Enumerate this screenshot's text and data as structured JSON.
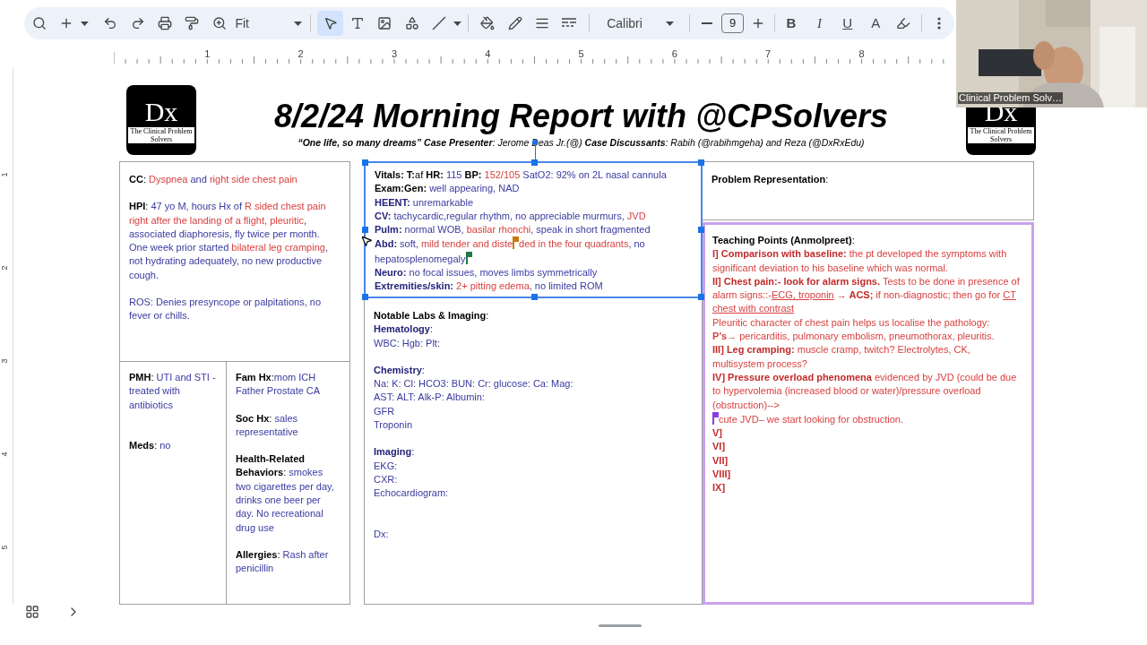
{
  "toolbar": {
    "zoom": "Fit",
    "tools": [
      {
        "selected": true
      },
      {
        "selected": false
      },
      {
        "selected": false
      },
      {
        "selected": false
      },
      {
        "selected": false
      }
    ],
    "font": "Calibri",
    "font_size": "9",
    "format_buttons": [
      "B",
      "I",
      "U",
      "A"
    ]
  },
  "ruler": {
    "numbers": [
      "1",
      "2",
      "3",
      "4",
      "5",
      "6",
      "7",
      "8"
    ]
  },
  "vertical_ruler": {
    "numbers": [
      "1",
      "2",
      "3",
      "4",
      "5"
    ]
  },
  "webcam": {
    "caption": "Clinical Problem Solv…"
  },
  "slide": {
    "logos": [
      {
        "letters": "Dx",
        "caption": "The Clinical Problem Solvers"
      },
      {
        "letters": "Dx",
        "caption": "The Clinical Problem Solvers"
      }
    ],
    "title": "8/2/24 Morning Report with @CPSolvers",
    "subtitle": "**“One life, so many dreams” Case Presenter**: Jerome Deas Jr.(@) **Case Discussants**: Rabih (@rabihmgeha) and Reza (@DxRxEdu)",
    "history": [
      [
        [
          {
            "text": "**CC**: ",
            "color": "#000000",
            "kind": "plain"
          },
          {
            "text": "Dyspnea",
            "color": "#d8403f",
            "kind": "plain"
          },
          {
            "text": " and ",
            "color": "#3a3aa0",
            "kind": "plain"
          },
          {
            "text": "right side chest pain",
            "color": "#d8403f",
            "kind": "plain"
          }
        ]
      ],
      [
        [
          {
            "text": "**HPI**:",
            "color": "#000000",
            "kind": "plain"
          },
          {
            "text": "  47 yo M, hours Hx of ",
            "color": "#3a3aa0",
            "kind": "plain"
          },
          {
            "text": "R sided chest pain right after the landing of a flight, pleuritic",
            "color": "#d8403f",
            "kind": "plain"
          },
          {
            "text": ", associated diaphoresis, fly twice per month. One week prior started ",
            "color": "#3a3aa0",
            "kind": "plain"
          },
          {
            "text": "bilateral leg cramping",
            "color": "#d8403f",
            "kind": "plain"
          },
          {
            "text": ",  not hydrating adequately, no new productive cough.",
            "color": "#3a3aa0",
            "kind": "plain"
          }
        ]
      ],
      [
        [
          {
            "text": "ROS: Denies presyncope or palpitations, no fever or chills.",
            "color": "#3a3aa0",
            "kind": "plain"
          }
        ]
      ]
    ],
    "pmh": [
      [
        [
          {
            "text": "**PMH**:  ",
            "color": "#000000",
            "kind": "plain"
          },
          {
            "text": "UTI and STI - treated with antibiotics",
            "color": "#3a3aa0",
            "kind": "plain"
          }
        ]
      ],
      [
        [
          {
            "text": "**Meds**: ",
            "color": "#000000",
            "kind": "plain"
          },
          {
            "text": "no",
            "color": "#3a3aa0",
            "kind": "plain"
          }
        ]
      ]
    ],
    "social": [
      [
        [
          {
            "text": "**Fam Hx**:",
            "color": "#000000",
            "kind": "plain"
          },
          {
            "text": "mom ICH Father Prostate CA",
            "color": "#3a3aa0",
            "kind": "plain"
          }
        ]
      ],
      [
        [
          {
            "text": "**Soc Hx**: ",
            "color": "#000000",
            "kind": "plain"
          },
          {
            "text": "sales representative",
            "color": "#3a3aa0",
            "kind": "plain"
          }
        ]
      ],
      [
        [
          {
            "text": "**Health-Related Behaviors**: ",
            "color": "#000000",
            "kind": "plain"
          },
          {
            "text": "smokes two cigarettes per day, drinks one beer per day. No recreational drug use",
            "color": "#3a3aa0",
            "kind": "plain"
          }
        ]
      ],
      [
        [
          {
            "text": "**Allergies**: ",
            "color": "#000000",
            "kind": "plain"
          },
          {
            "text": "Rash after penicillin",
            "color": "#3a3aa0",
            "kind": "plain"
          }
        ]
      ]
    ],
    "exam": [
      [
        [
          {
            "text": "**Vitals: T:**af",
            "color": "#000000",
            "kind": "plain"
          },
          {
            "text": " **HR:**",
            "color": "#000000",
            "kind": "plain"
          },
          {
            "text": " 115 ",
            "color": "#3a3aa0",
            "kind": "plain"
          },
          {
            "text": "**BP:**",
            "color": "#000000",
            "kind": "plain"
          },
          {
            "text": " 152/105",
            "color": "#d8403f",
            "kind": "plain"
          },
          {
            "text": " SatO2: 92% on 2L nasal cannula",
            "color": "#3a3aa0",
            "kind": "plain"
          }
        ],
        [
          {
            "text": "**Exam:Gen:**",
            "color": "#000000",
            "kind": "plain"
          },
          {
            "text": " well appearing, NAD",
            "color": "#3a3aa0",
            "kind": "plain"
          }
        ],
        [
          {
            "text": "**HEENT:**",
            "color": "#23237a",
            "kind": "plain"
          },
          {
            "text": " unremarkable",
            "color": "#3a3aa0",
            "kind": "plain"
          }
        ],
        [
          {
            "text": "**CV:**",
            "color": "#23237a",
            "kind": "plain"
          },
          {
            "text": " tachycardic,regular rhythm, no appreciable murmurs, ",
            "color": "#3a3aa0",
            "kind": "plain"
          },
          {
            "text": "JVD",
            "color": "#d8403f",
            "kind": "plain"
          }
        ],
        [
          {
            "text": "**Pulm:**",
            "color": "#23237a",
            "kind": "plain"
          },
          {
            "text": " normal WOB, ",
            "color": "#3a3aa0",
            "kind": "plain"
          },
          {
            "text": "basilar rhonchi",
            "color": "#d8403f",
            "kind": "plain"
          },
          {
            "text": ", speak in short fragmented",
            "color": "#3a3aa0",
            "kind": "plain"
          }
        ],
        [
          {
            "text": "**Abd:**",
            "color": "#23237a",
            "kind": "plain"
          },
          {
            "text": " soft, ",
            "color": "#3a3aa0",
            "kind": "plain"
          },
          {
            "text": "mild tender and diste",
            "color": "#d8403f",
            "kind": "plain"
          },
          {
            "color": "#c77a0a",
            "kind": "cursor"
          },
          {
            "text": "ded in the four quadrants",
            "color": "#d8403f",
            "kind": "plain"
          },
          {
            "text": ", no hepatosplenomegaly",
            "color": "#3a3aa0",
            "kind": "plain"
          },
          {
            "color": "#1e7a45",
            "kind": "cursor"
          }
        ],
        [
          {
            "text": "**Neuro:**",
            "color": "#23237a",
            "kind": "plain"
          },
          {
            "text": " no focal issues, moves limbs symmetrically",
            "color": "#3a3aa0",
            "kind": "plain"
          }
        ],
        [
          {
            "text": "**Extremities/skin:**",
            "color": "#23237a",
            "kind": "plain"
          },
          {
            "text": " 2+ pitting edema",
            "color": "#d8403f",
            "kind": "plain"
          },
          {
            "text": ", no limited ROM",
            "color": "#3a3aa0",
            "kind": "plain"
          }
        ]
      ]
    ],
    "labs": [
      [
        [
          {
            "text": "**Notable Labs & Imaging**:",
            "color": "#000000",
            "kind": "plain"
          }
        ],
        [
          {
            "text": "**Hematology**:",
            "color": "#23237a",
            "kind": "plain"
          }
        ],
        [
          {
            "text": "WBC: Hgb: Plt:",
            "color": "#3a3aa0",
            "kind": "plain"
          }
        ]
      ],
      [
        [
          {
            "text": "**Chemistry**:",
            "color": "#23237a",
            "kind": "plain"
          }
        ],
        [
          {
            "text": "Na: K: Cl: HCO3: BUN: Cr: glucose: Ca: Mag:",
            "color": "#3a3aa0",
            "kind": "plain"
          }
        ],
        [
          {
            "text": "AST:  ALT:  Alk-P: Albumin:",
            "color": "#3a3aa0",
            "kind": "plain"
          }
        ],
        [
          {
            "text": "GFR",
            "color": "#3a3aa0",
            "kind": "plain"
          }
        ],
        [
          {
            "text": "Troponin",
            "color": "#3a3aa0",
            "kind": "plain"
          }
        ]
      ],
      [
        [
          {
            "text": "**Imaging**:",
            "color": "#23237a",
            "kind": "plain"
          }
        ],
        [
          {
            "text": "EKG:",
            "color": "#3a3aa0",
            "kind": "plain"
          }
        ],
        [
          {
            "text": "CXR:",
            "color": "#3a3aa0",
            "kind": "plain"
          }
        ],
        [
          {
            "text": "Echocardiogram:",
            "color": "#3a3aa0",
            "kind": "plain"
          }
        ]
      ],
      [
        [
          {
            "text": "Dx:",
            "color": "#3a3aa0",
            "kind": "plain"
          }
        ]
      ]
    ],
    "problem": [
      [
        [
          {
            "text": "**Problem Representation**:",
            "color": "#000000",
            "kind": "plain"
          }
        ]
      ]
    ],
    "teaching": [
      [
        [
          {
            "text": "**Teaching Points (Anmolpreet)**:",
            "color": "#000000",
            "kind": "plain"
          }
        ],
        [
          {
            "text": "**I] Comparison with baseline:**",
            "color": "#c42a2a",
            "kind": "plain"
          },
          {
            "text": " the pt developed the symptoms with significant deviation to his baseline which was normal.",
            "color": "#d8403f",
            "kind": "plain"
          }
        ],
        [
          {
            "text": "**II] Chest pain:- look for alarm signs.**",
            "color": "#c42a2a",
            "kind": "plain"
          },
          {
            "text": " Tests to be done in presence of alarm signs::-",
            "color": "#d8403f",
            "kind": "plain"
          },
          {
            "text": "ECG, troponin",
            "color": "#d8403f",
            "kind": "underlined"
          },
          {
            "text": " **→ ACS;**",
            "color": "#c42a2a",
            "kind": "plain"
          },
          {
            "text": " if non-diagnostic; then go for ",
            "color": "#d8403f",
            "kind": "plain"
          },
          {
            "text": "CT chest with contrast",
            "color": "#d8403f",
            "kind": "underlined"
          }
        ],
        [
          {
            "text": "Pleuritic character of chest pain helps us localise the pathology:",
            "color": "#d8403f",
            "kind": "plain"
          }
        ],
        [
          {
            "text": "**P’s**→ pericarditis, pulmonary embolism, pneumothorax, pleuritis.",
            "color": "#d8403f",
            "kind": "plain"
          }
        ],
        [
          {
            "text": "**III] Leg cramping:**",
            "color": "#c42a2a",
            "kind": "plain"
          },
          {
            "text": " muscle cramp, twitch? Electrolytes, CK, multisystem process?",
            "color": "#d8403f",
            "kind": "plain"
          }
        ],
        [
          {
            "text": "**IV] Pressure overload phenomena**",
            "color": "#c42a2a",
            "kind": "plain"
          },
          {
            "text": " evidenced by JVD (could be due to hypervolemia (increased blood or water)/pressure overload (obstruction)-->",
            "color": "#d8403f",
            "kind": "plain"
          }
        ],
        [
          {
            "color": "#8a3ee0",
            "kind": "cursor"
          },
          {
            "text": "cute JVD– we start looking for obstruction.",
            "color": "#d8403f",
            "kind": "plain"
          }
        ],
        [
          {
            "text": "**V]**",
            "color": "#c42a2a",
            "kind": "plain"
          }
        ],
        [
          {
            "text": "**VI]**",
            "color": "#c42a2a",
            "kind": "plain"
          }
        ],
        [
          {
            "text": "**VII]**",
            "color": "#c42a2a",
            "kind": "plain"
          }
        ],
        [
          {
            "text": "**VIII]**",
            "color": "#c42a2a",
            "kind": "plain"
          }
        ],
        [
          {
            "text": "**IX]**",
            "color": "#c42a2a",
            "kind": "plain"
          }
        ]
      ]
    ]
  }
}
